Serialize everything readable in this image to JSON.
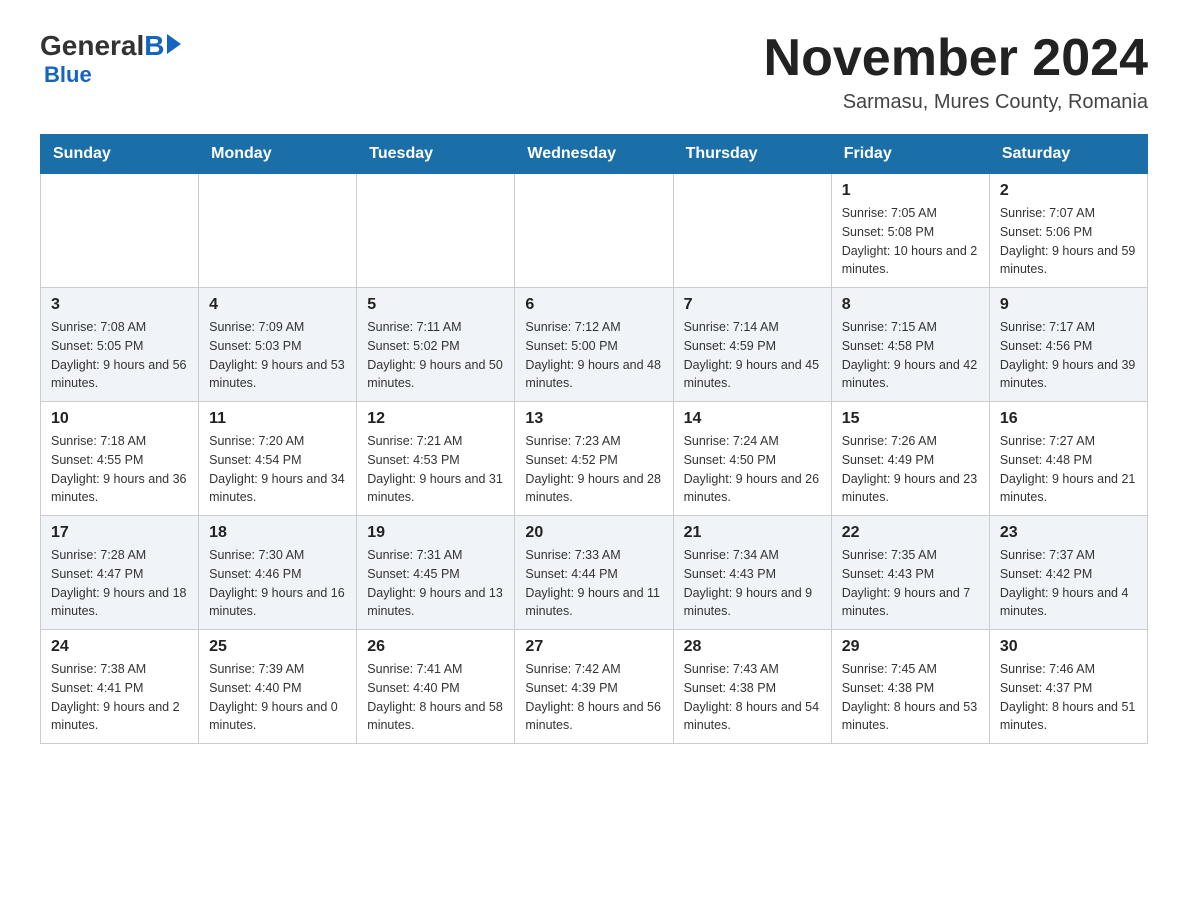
{
  "header": {
    "logo_general": "General",
    "logo_blue": "Blue",
    "month_title": "November 2024",
    "location": "Sarmasu, Mures County, Romania"
  },
  "weekdays": [
    "Sunday",
    "Monday",
    "Tuesday",
    "Wednesday",
    "Thursday",
    "Friday",
    "Saturday"
  ],
  "weeks": [
    {
      "alt": false,
      "days": [
        {
          "num": "",
          "info": ""
        },
        {
          "num": "",
          "info": ""
        },
        {
          "num": "",
          "info": ""
        },
        {
          "num": "",
          "info": ""
        },
        {
          "num": "",
          "info": ""
        },
        {
          "num": "1",
          "info": "Sunrise: 7:05 AM\nSunset: 5:08 PM\nDaylight: 10 hours and 2 minutes."
        },
        {
          "num": "2",
          "info": "Sunrise: 7:07 AM\nSunset: 5:06 PM\nDaylight: 9 hours and 59 minutes."
        }
      ]
    },
    {
      "alt": true,
      "days": [
        {
          "num": "3",
          "info": "Sunrise: 7:08 AM\nSunset: 5:05 PM\nDaylight: 9 hours and 56 minutes."
        },
        {
          "num": "4",
          "info": "Sunrise: 7:09 AM\nSunset: 5:03 PM\nDaylight: 9 hours and 53 minutes."
        },
        {
          "num": "5",
          "info": "Sunrise: 7:11 AM\nSunset: 5:02 PM\nDaylight: 9 hours and 50 minutes."
        },
        {
          "num": "6",
          "info": "Sunrise: 7:12 AM\nSunset: 5:00 PM\nDaylight: 9 hours and 48 minutes."
        },
        {
          "num": "7",
          "info": "Sunrise: 7:14 AM\nSunset: 4:59 PM\nDaylight: 9 hours and 45 minutes."
        },
        {
          "num": "8",
          "info": "Sunrise: 7:15 AM\nSunset: 4:58 PM\nDaylight: 9 hours and 42 minutes."
        },
        {
          "num": "9",
          "info": "Sunrise: 7:17 AM\nSunset: 4:56 PM\nDaylight: 9 hours and 39 minutes."
        }
      ]
    },
    {
      "alt": false,
      "days": [
        {
          "num": "10",
          "info": "Sunrise: 7:18 AM\nSunset: 4:55 PM\nDaylight: 9 hours and 36 minutes."
        },
        {
          "num": "11",
          "info": "Sunrise: 7:20 AM\nSunset: 4:54 PM\nDaylight: 9 hours and 34 minutes."
        },
        {
          "num": "12",
          "info": "Sunrise: 7:21 AM\nSunset: 4:53 PM\nDaylight: 9 hours and 31 minutes."
        },
        {
          "num": "13",
          "info": "Sunrise: 7:23 AM\nSunset: 4:52 PM\nDaylight: 9 hours and 28 minutes."
        },
        {
          "num": "14",
          "info": "Sunrise: 7:24 AM\nSunset: 4:50 PM\nDaylight: 9 hours and 26 minutes."
        },
        {
          "num": "15",
          "info": "Sunrise: 7:26 AM\nSunset: 4:49 PM\nDaylight: 9 hours and 23 minutes."
        },
        {
          "num": "16",
          "info": "Sunrise: 7:27 AM\nSunset: 4:48 PM\nDaylight: 9 hours and 21 minutes."
        }
      ]
    },
    {
      "alt": true,
      "days": [
        {
          "num": "17",
          "info": "Sunrise: 7:28 AM\nSunset: 4:47 PM\nDaylight: 9 hours and 18 minutes."
        },
        {
          "num": "18",
          "info": "Sunrise: 7:30 AM\nSunset: 4:46 PM\nDaylight: 9 hours and 16 minutes."
        },
        {
          "num": "19",
          "info": "Sunrise: 7:31 AM\nSunset: 4:45 PM\nDaylight: 9 hours and 13 minutes."
        },
        {
          "num": "20",
          "info": "Sunrise: 7:33 AM\nSunset: 4:44 PM\nDaylight: 9 hours and 11 minutes."
        },
        {
          "num": "21",
          "info": "Sunrise: 7:34 AM\nSunset: 4:43 PM\nDaylight: 9 hours and 9 minutes."
        },
        {
          "num": "22",
          "info": "Sunrise: 7:35 AM\nSunset: 4:43 PM\nDaylight: 9 hours and 7 minutes."
        },
        {
          "num": "23",
          "info": "Sunrise: 7:37 AM\nSunset: 4:42 PM\nDaylight: 9 hours and 4 minutes."
        }
      ]
    },
    {
      "alt": false,
      "days": [
        {
          "num": "24",
          "info": "Sunrise: 7:38 AM\nSunset: 4:41 PM\nDaylight: 9 hours and 2 minutes."
        },
        {
          "num": "25",
          "info": "Sunrise: 7:39 AM\nSunset: 4:40 PM\nDaylight: 9 hours and 0 minutes."
        },
        {
          "num": "26",
          "info": "Sunrise: 7:41 AM\nSunset: 4:40 PM\nDaylight: 8 hours and 58 minutes."
        },
        {
          "num": "27",
          "info": "Sunrise: 7:42 AM\nSunset: 4:39 PM\nDaylight: 8 hours and 56 minutes."
        },
        {
          "num": "28",
          "info": "Sunrise: 7:43 AM\nSunset: 4:38 PM\nDaylight: 8 hours and 54 minutes."
        },
        {
          "num": "29",
          "info": "Sunrise: 7:45 AM\nSunset: 4:38 PM\nDaylight: 8 hours and 53 minutes."
        },
        {
          "num": "30",
          "info": "Sunrise: 7:46 AM\nSunset: 4:37 PM\nDaylight: 8 hours and 51 minutes."
        }
      ]
    }
  ]
}
